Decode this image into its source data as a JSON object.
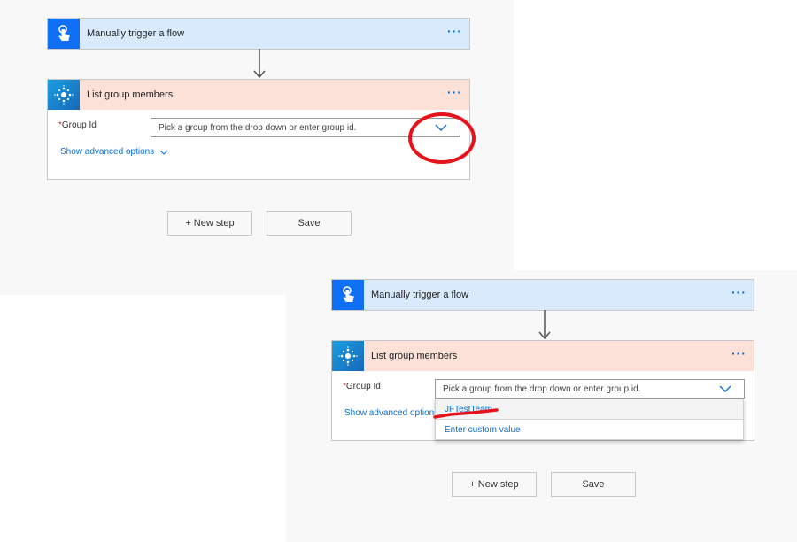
{
  "top_panel": {
    "trigger_card": {
      "title": "Manually trigger a flow",
      "more": "···",
      "icon": "touch-hand-icon"
    },
    "action_card": {
      "title": "List group members",
      "more": "···",
      "icon": "group-network-icon",
      "field": {
        "required_mark": "*",
        "label": "Group Id",
        "placeholder": "Pick a group from the drop down or enter group id."
      },
      "advanced_label": "Show advanced options"
    },
    "buttons": {
      "new_step": "+ New step",
      "save": "Save"
    }
  },
  "bottom_panel": {
    "trigger_card": {
      "title": "Manually trigger a flow",
      "more": "···",
      "icon": "touch-hand-icon"
    },
    "action_card": {
      "title": "List group members",
      "more": "···",
      "icon": "group-network-icon",
      "field": {
        "required_mark": "*",
        "label": "Group Id",
        "placeholder": "Pick a group from the drop down or enter group id."
      },
      "advanced_label": "Show advanced options",
      "dropdown_options": [
        "JFTestTeam",
        "Enter custom value"
      ]
    },
    "buttons": {
      "new_step": "+ New step",
      "save": "Save"
    }
  },
  "colors": {
    "trigger_header": "#d9eafd",
    "action_header": "#fce1d9",
    "link_blue": "#0a6fd1",
    "annotation_red": "#e8121a"
  }
}
